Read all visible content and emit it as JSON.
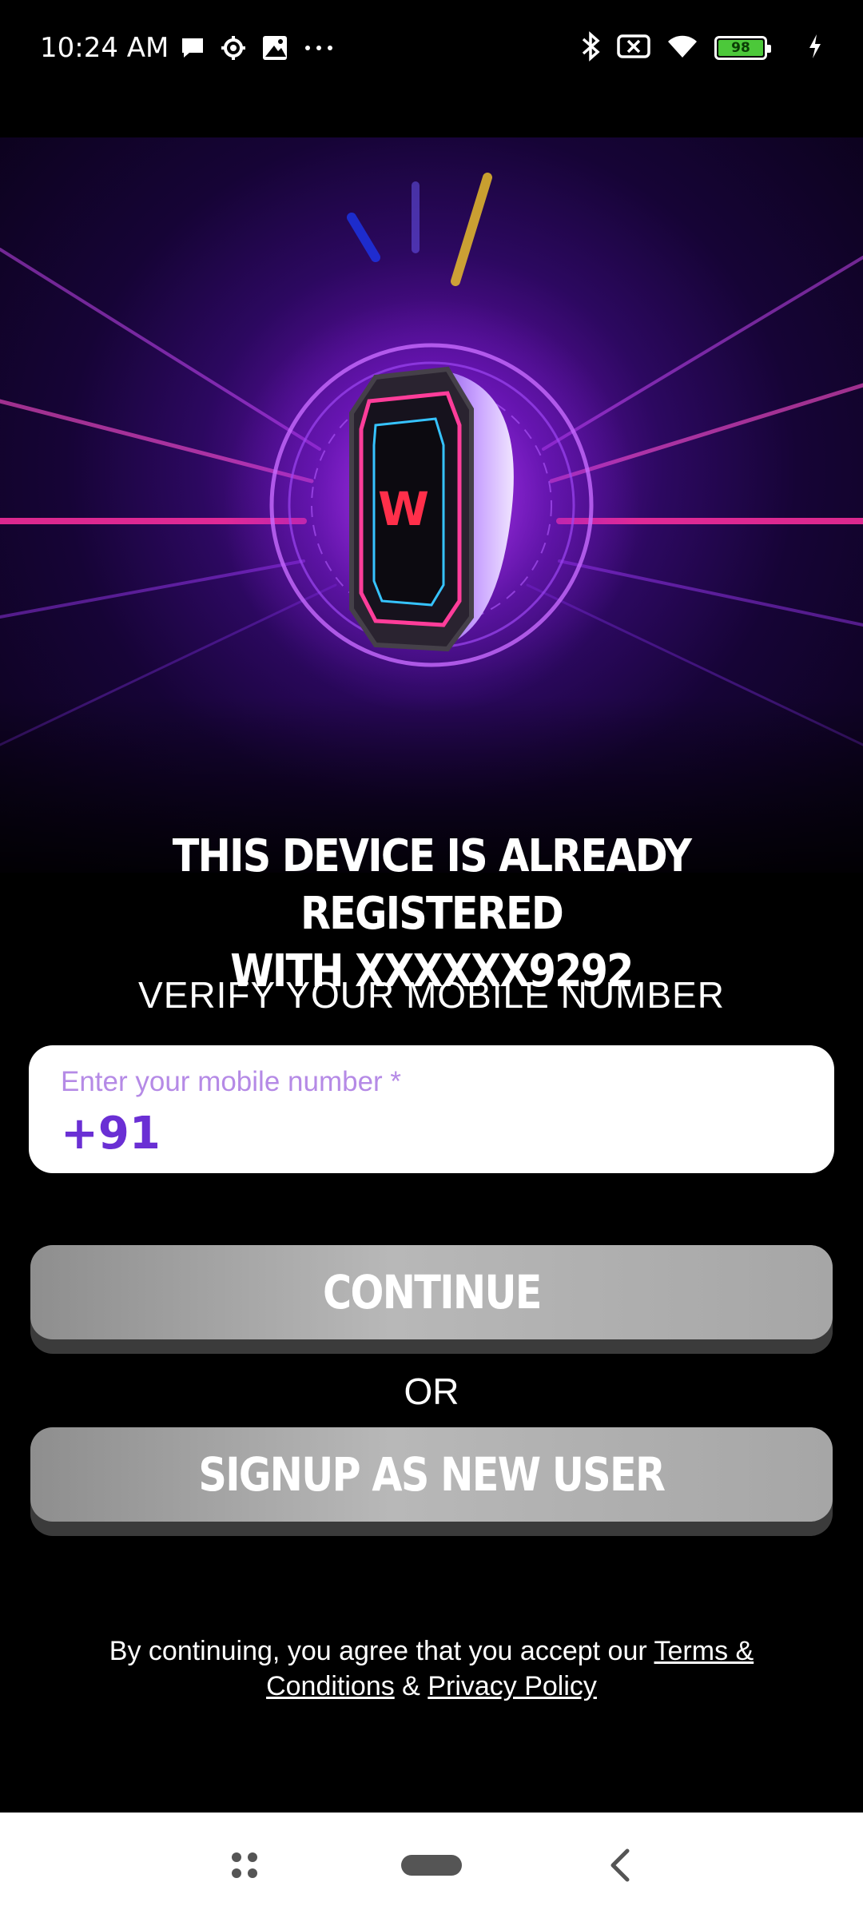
{
  "status_bar": {
    "time": "10:24 AM",
    "battery_level": "98",
    "icons_left": [
      "message-icon",
      "gear-icon",
      "image-icon",
      "more-dots-icon"
    ],
    "icons_right": [
      "bluetooth-icon",
      "no-sim-icon",
      "wifi-icon",
      "battery-icon",
      "charging-icon"
    ]
  },
  "hero": {
    "image": "smartwatch-hero-illustration",
    "logo_letter": "W"
  },
  "headline": {
    "line1": "THIS DEVICE IS ALREADY REGISTERED",
    "line2": "WITH XXXXXX9292"
  },
  "subheadline": "VERIFY YOUR MOBILE NUMBER",
  "phone_field": {
    "label": "Enter your mobile number *",
    "value": "+91"
  },
  "buttons": {
    "continue": "CONTINUE",
    "or": "OR",
    "signup": "SIGNUP AS NEW USER"
  },
  "terms": {
    "prefix": "By continuing, you agree that you accept our ",
    "terms_link": "Terms & Conditions",
    "and": " & ",
    "privacy_link": "Privacy Policy"
  },
  "nav_bar": {
    "icons": [
      "recent-apps-icon",
      "home-pill-icon",
      "back-icon"
    ]
  },
  "colors": {
    "accent": "#6a2fd4",
    "label": "#b58ae6",
    "button": "#a6a6a6",
    "background": "#000000"
  }
}
